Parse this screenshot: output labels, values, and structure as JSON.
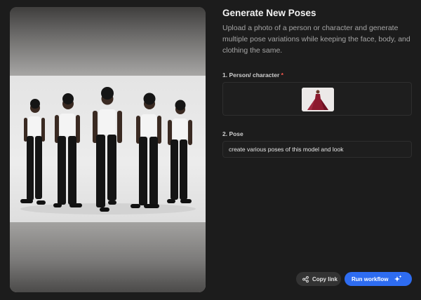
{
  "preview": {
    "image_alt": "Five men in white tank tops and black pants posing against a light grey backdrop"
  },
  "panel": {
    "title": "Generate New Poses",
    "description": "Upload a photo of a person or character and generate multiple pose variations while keeping the face, body, and clothing the same.",
    "person_field": {
      "label": "1. Person/ character",
      "required_mark": "*"
    },
    "pose_field": {
      "label": "2. Pose",
      "value": "create various poses of this model and look"
    }
  },
  "actions": {
    "copy_link_label": "Copy link",
    "copy_icon": "share-icon",
    "run_label": "Run workflow",
    "run_icon": "sparkle-icon"
  },
  "colors": {
    "background": "#1c1c1c",
    "accent": "#2e6cf0",
    "required": "#ff5a4f"
  }
}
